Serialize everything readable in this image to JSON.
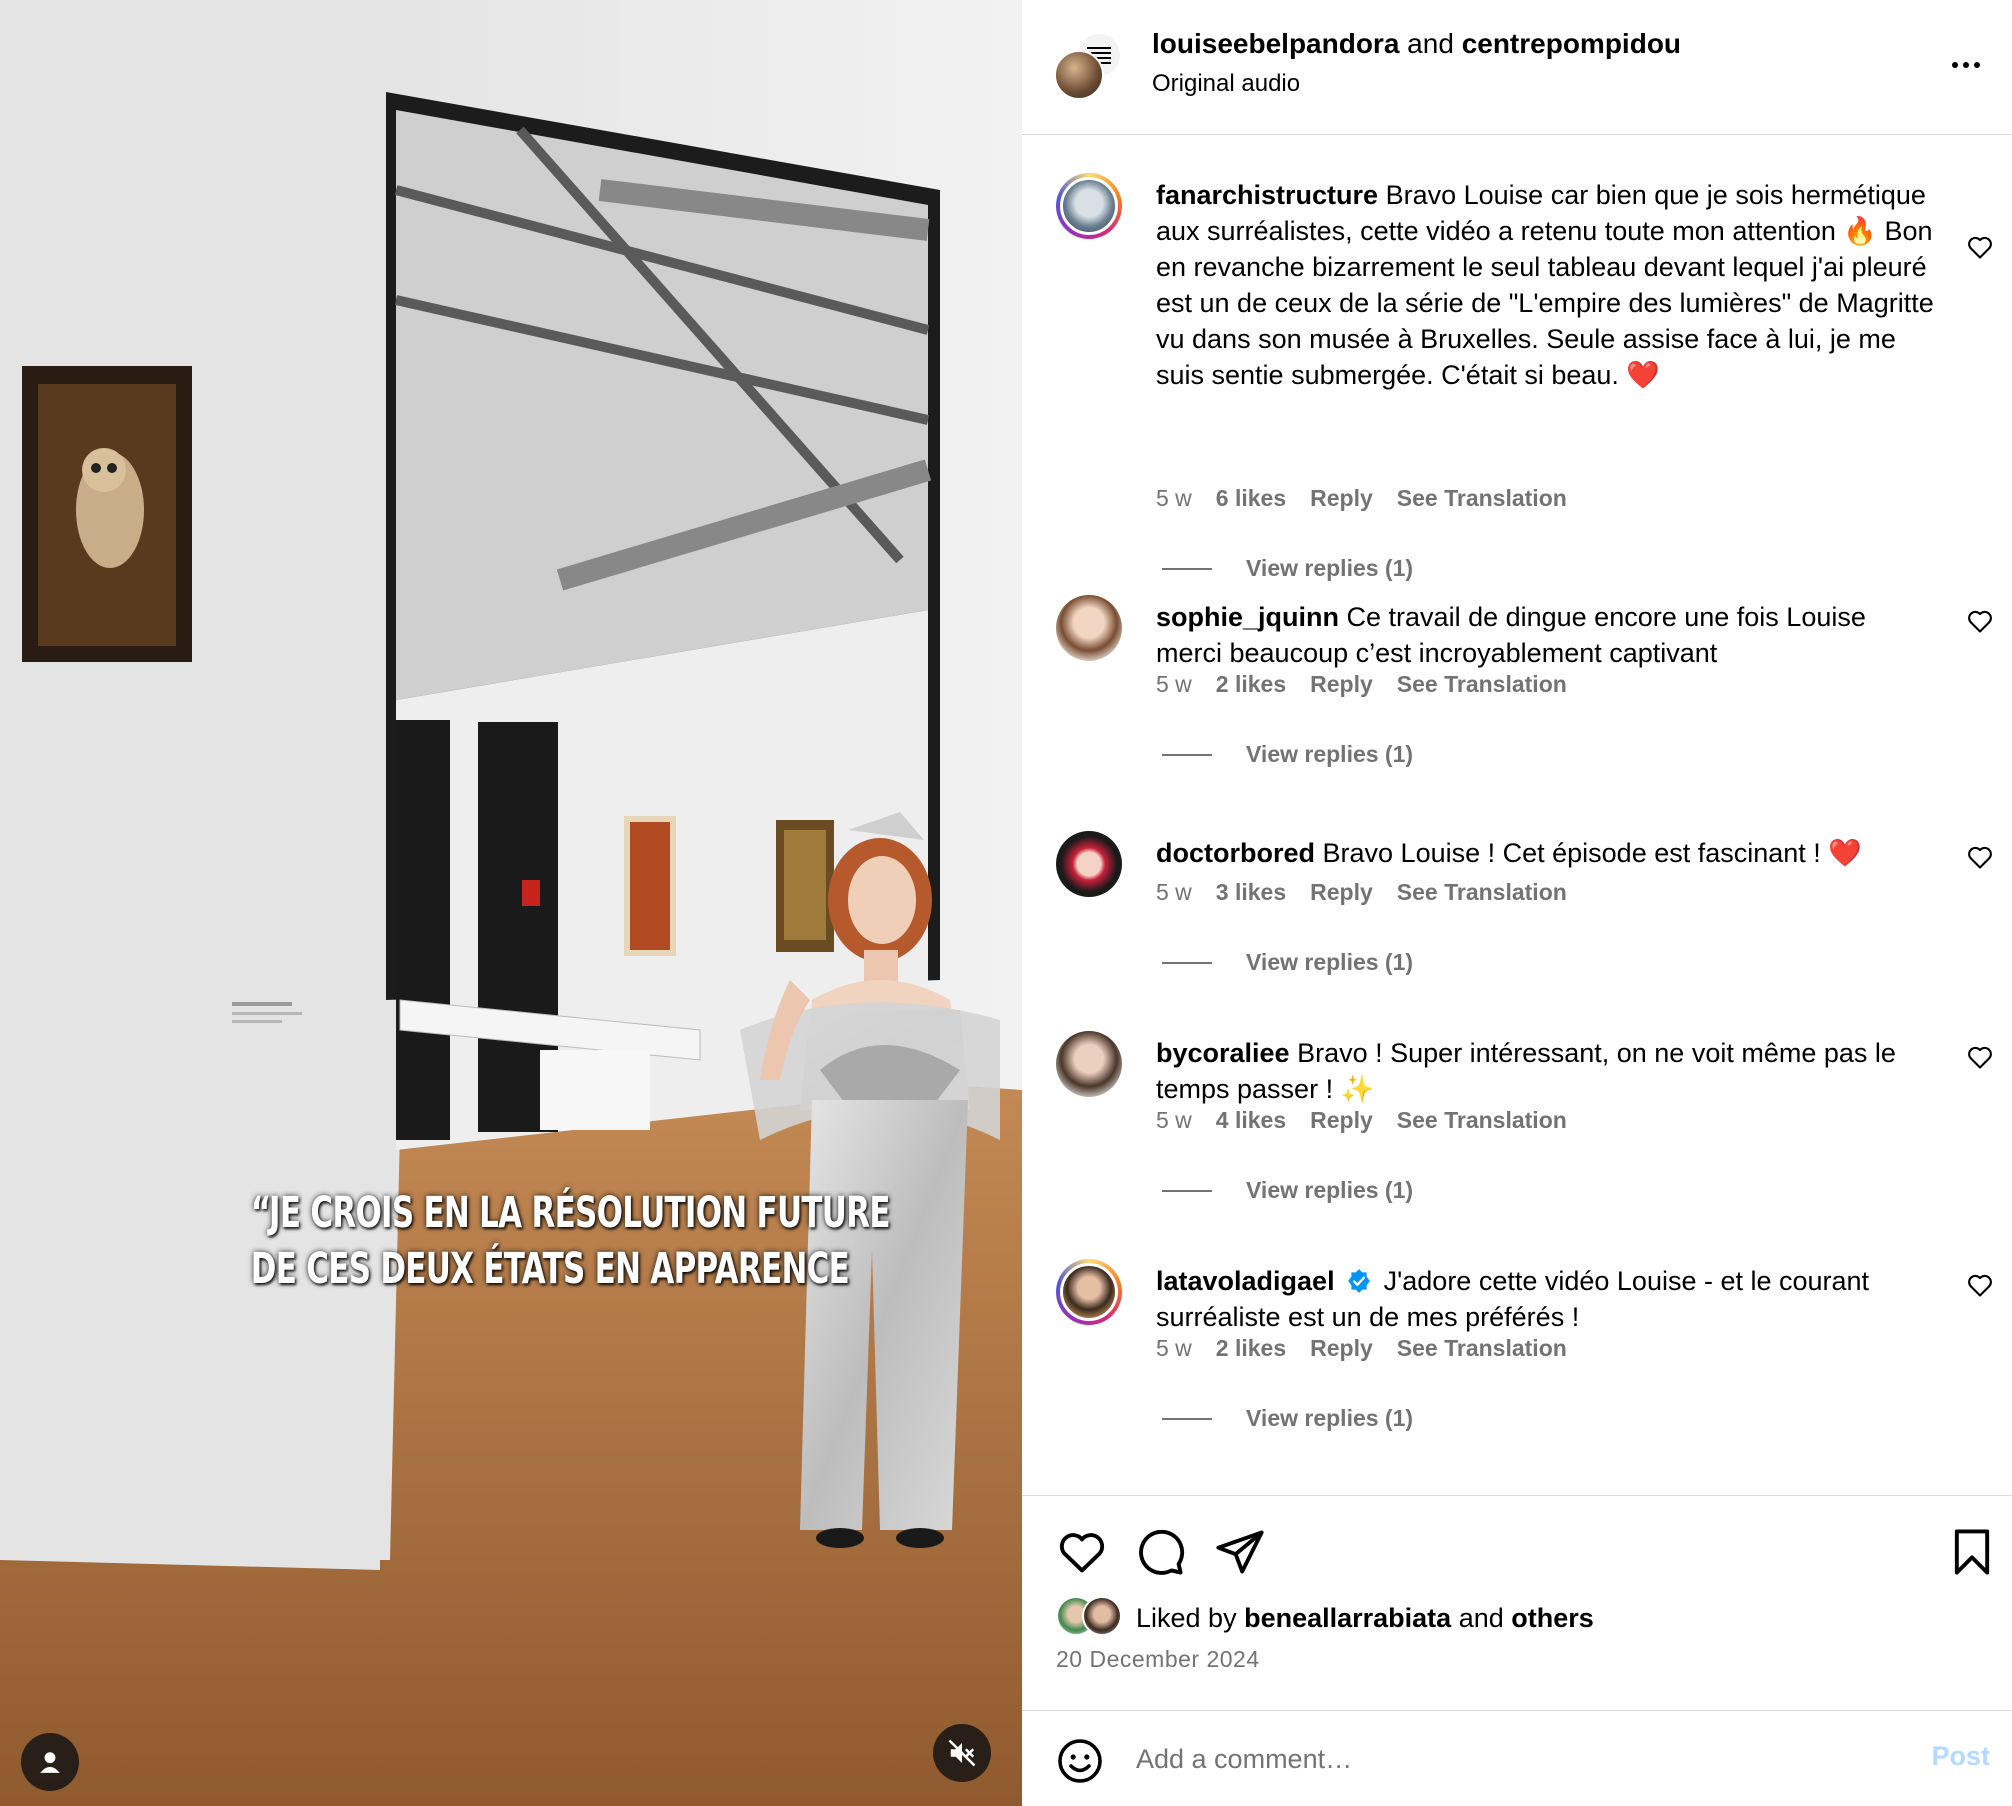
{
  "media": {
    "overlay_lines": [
      "“JE CROIS EN LA RÉSOLUTION FUTURE",
      "DE CES DEUX ÉTATS EN APPARENCE"
    ],
    "user_icon": "user-icon",
    "mute_icon": "muted-speaker-icon"
  },
  "header": {
    "user1": "louiseebelpandora",
    "joiner": " and ",
    "user2": "centrepompidou",
    "audio": "Original audio",
    "more_icon": "more-dots-icon"
  },
  "comments": [
    {
      "username": "fanarchistructure",
      "text": "Bravo Louise car bien que je sois hermétique aux surréalistes, cette vidéo a retenu toute mon attention 🔥 Bon en revanche bizarrement le seul tableau devant lequel j'ai pleuré est un de ceux de la série de \"L'empire des lumières\" de Magritte vu dans son musée à Bruxelles. Seule assise face à lui, je me suis sentie submergée. C'était si beau. ❤️",
      "time": "5 w",
      "likes": "6 likes",
      "reply": "Reply",
      "translate": "See Translation",
      "view_replies": "View replies (1)",
      "ring": true
    },
    {
      "username": "sophie_jquinn",
      "text": "Ce travail de dingue encore une fois Louise merci beaucoup c’est incroyablement captivant",
      "time": "5 w",
      "likes": "2 likes",
      "reply": "Reply",
      "translate": "See Translation",
      "view_replies": "View replies (1)",
      "ring": false
    },
    {
      "username": "doctorbored",
      "text": "Bravo Louise ! Cet épisode est fascinant ! ❤️",
      "time": "5 w",
      "likes": "3 likes",
      "reply": "Reply",
      "translate": "See Translation",
      "view_replies": "View replies (1)",
      "ring": false
    },
    {
      "username": "bycoraliee",
      "text": "Bravo ! Super intéressant, on ne voit même pas le temps passer ! ✨",
      "time": "5 w",
      "likes": "4 likes",
      "reply": "Reply",
      "translate": "See Translation",
      "view_replies": "View replies (1)",
      "ring": false
    },
    {
      "username": "latavoladigael",
      "verified": true,
      "text": "J'adore cette vidéo Louise - et le courant surréaliste est un de mes préférés !",
      "time": "5 w",
      "likes": "2 likes",
      "reply": "Reply",
      "translate": "See Translation",
      "view_replies": "View replies (1)",
      "ring": true
    }
  ],
  "actions": {
    "like_icon": "heart-icon",
    "comment_icon": "comment-bubble-icon",
    "share_icon": "paper-plane-icon",
    "save_icon": "bookmark-icon",
    "liked_by_prefix": "Liked by ",
    "liked_by_user": "beneallarrabiata",
    "liked_by_and": " and ",
    "liked_by_others": "others",
    "date": "20 December 2024"
  },
  "composer": {
    "placeholder": "Add a comment…",
    "post_label": "Post",
    "emoji_icon": "smiley-icon"
  },
  "colors": {
    "meta_gray": "#737373",
    "post_disabled": "#b3dbff",
    "verified_blue": "#0095f6",
    "divider": "#dbdbdb"
  }
}
